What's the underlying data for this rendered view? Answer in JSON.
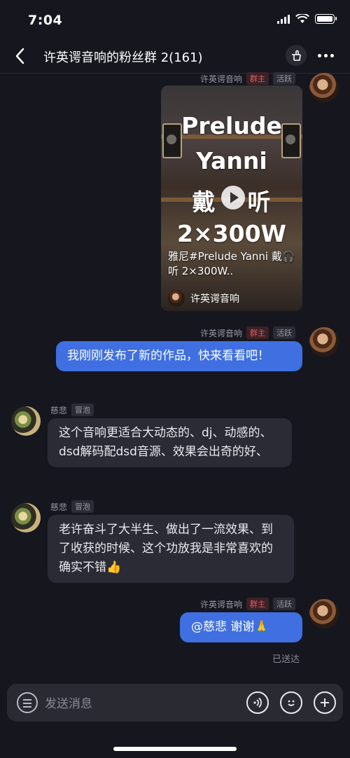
{
  "status": {
    "time": "7:04"
  },
  "header": {
    "title": "许英谔音响的粉丝群 2(161)"
  },
  "messages": {
    "m1": {
      "sender": "许英谔音响",
      "role": "群主",
      "activity": "活跃",
      "video": {
        "lines": [
          "Prelude",
          "Yanni",
          "戴",
          "听",
          "2×300W"
        ],
        "caption": "雅尼#Prelude Yanni 戴🎧听 2×300W..",
        "author": "许英谔音响"
      }
    },
    "m2": {
      "sender": "许英谔音响",
      "role": "群主",
      "activity": "活跃",
      "text": "我刚刚发布了新的作品，快来看看吧！"
    },
    "m3": {
      "sender": "慈悲",
      "activity": "冒泡",
      "text": "这个音响更适合大动态的、dj、动感的、dsd解码配dsd音源、效果会出奇的好、"
    },
    "m4": {
      "sender": "慈悲",
      "activity": "冒泡",
      "text": "老许奋斗了大半生、做出了一流效果、到了收获的时候、这个功放我是非常喜欢的确实不错👍"
    },
    "m5": {
      "sender": "许英谔音响",
      "role": "群主",
      "activity": "活跃",
      "text": "@慈悲 谢谢🙏"
    }
  },
  "sent_status": "已送达",
  "input": {
    "placeholder": "发送消息"
  },
  "colors": {
    "bubble_blue": "#3f6fe0",
    "bubble_dark": "#2b2b35",
    "owner_tag": "#e65a5a"
  }
}
